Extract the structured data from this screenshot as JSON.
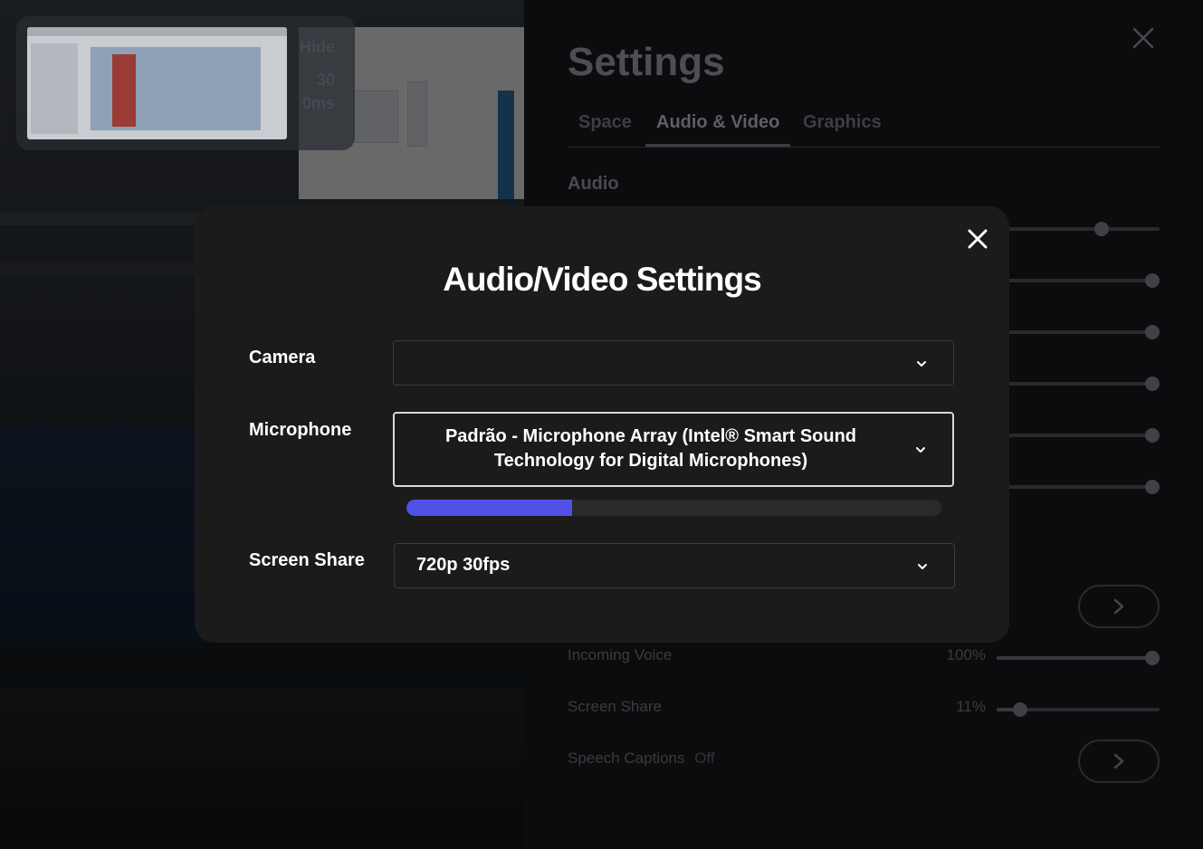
{
  "background_scene": {
    "preview": {
      "hide_label": "Hide",
      "stat_1": "30",
      "stat_2": "0ms"
    }
  },
  "settings": {
    "title": "Settings",
    "tabs": [
      {
        "label": "Space",
        "active": false
      },
      {
        "label": "Audio & Video",
        "active": true
      },
      {
        "label": "Graphics",
        "active": false
      }
    ],
    "section_audio": "Audio",
    "sliders_hidden": [
      {
        "level": 0.66
      },
      {
        "level": 1.0
      },
      {
        "level": 1.0
      },
      {
        "level": 1.0
      },
      {
        "level": 1.0
      },
      {
        "level": 1.0
      }
    ],
    "rows": [
      {
        "label": "Incoming Voice",
        "value": "100%",
        "level": 1.0
      },
      {
        "label": "Screen Share",
        "value": "11%",
        "level": 0.11
      }
    ],
    "speech_captions": {
      "label": "Speech Captions",
      "state": "Off"
    }
  },
  "modal": {
    "title": "Audio/Video Settings",
    "camera": {
      "label": "Camera",
      "value": ""
    },
    "microphone": {
      "label": "Microphone",
      "value_line1": "Padrão - Microphone Array (Intel® Smart Sound",
      "value_line2": "Technology for Digital Microphones)",
      "input_level": 0.31
    },
    "screen_share": {
      "label": "Screen Share",
      "value": "720p 30fps"
    }
  },
  "colors": {
    "accent": "#5150e8",
    "modal_bg": "#1b1b1c",
    "panel_bg": "#0c0c0e"
  },
  "icons": {
    "close": "close-icon",
    "chevron": "chevron-down-icon",
    "arrow": "chevron-right-icon"
  }
}
